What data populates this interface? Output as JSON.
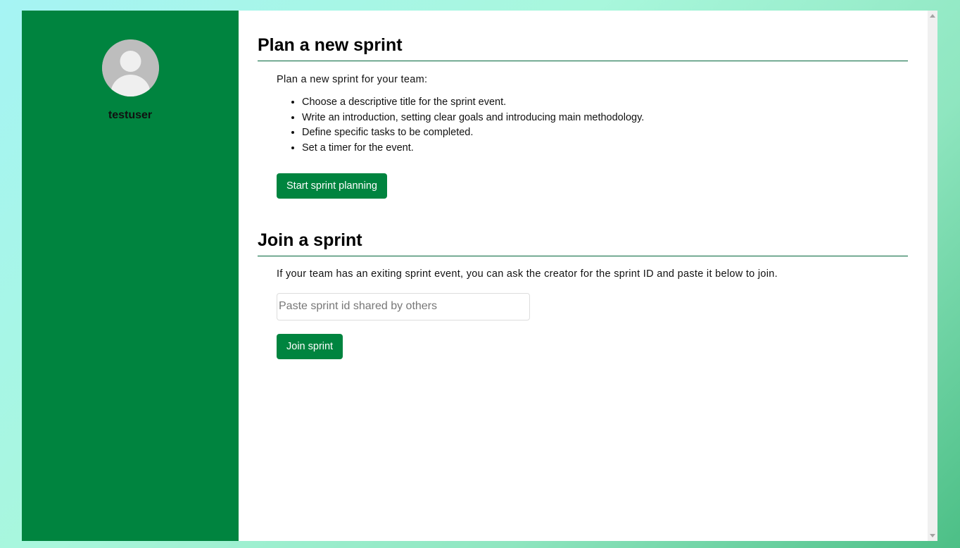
{
  "sidebar": {
    "avatar_icon": "user-avatar-icon",
    "username": "testuser",
    "background_color": "#00843f"
  },
  "plan": {
    "title": "Plan a new sprint",
    "intro": "Plan a new sprint for your team:",
    "steps": [
      "Choose a descriptive title for the sprint event.",
      "Write an introduction, setting clear goals and introducing main methodology.",
      "Define specific tasks to be completed.",
      "Set a timer for the event."
    ],
    "button_label": "Start sprint planning"
  },
  "join": {
    "title": "Join a sprint",
    "description": "If your team has an exiting sprint event, you can ask the creator for the sprint ID and paste it below to join.",
    "input_placeholder": "Paste sprint id shared by others",
    "input_value": "",
    "button_label": "Join sprint"
  },
  "colors": {
    "accent": "#00843f",
    "divider": "#00643a"
  }
}
